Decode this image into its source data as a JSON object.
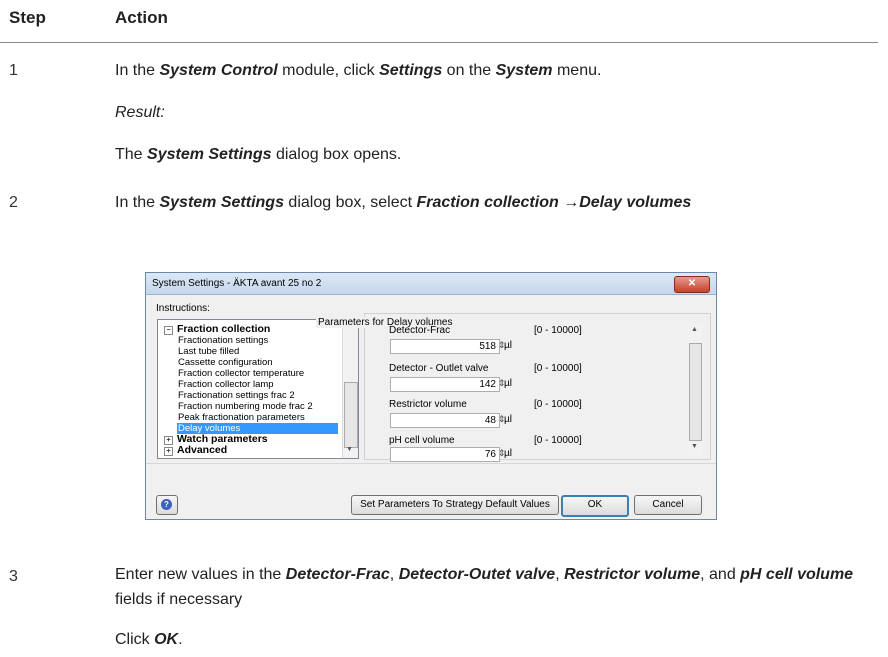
{
  "header": {
    "step": "Step",
    "action": "Action"
  },
  "steps": [
    {
      "num": "1",
      "line1": {
        "a": "In the ",
        "b": "System Control",
        "c": " module, click ",
        "d": "Settings",
        "e": " on the ",
        "f": "System",
        "g": " menu."
      },
      "result_label": "Result:",
      "result": {
        "a": "The ",
        "b": "System Settings",
        "c": " dialog box opens."
      }
    },
    {
      "num": "2",
      "line1": {
        "a": "In the ",
        "b": "System Settings",
        "c": " dialog box, select ",
        "d": "Fraction collection",
        "e": " →",
        "f": "Delay volumes"
      }
    },
    {
      "num": "3",
      "line1": {
        "a": "Enter new values in the ",
        "b": "Detector-Frac",
        "c": ", ",
        "d": "Detector-Outet valve",
        "e": ", ",
        "f": "Restrictor volume",
        "g": ", and ",
        "h": "pH cell volume",
        "i": " fields if necessary"
      },
      "line2": {
        "a": "Click ",
        "b": "OK",
        "c": "."
      }
    }
  ],
  "dialog": {
    "title": "System Settings - ÄKTA avant 25  no 2",
    "close": "✕",
    "instructions_label": "Instructions:",
    "tree": [
      {
        "label": "Fraction collection",
        "level": "top",
        "expander": "−"
      },
      {
        "label": "Fractionation settings",
        "level": "child"
      },
      {
        "label": "Last tube filled",
        "level": "child"
      },
      {
        "label": "Cassette configuration",
        "level": "child"
      },
      {
        "label": "Fraction collector temperature",
        "level": "child"
      },
      {
        "label": "Fraction collector lamp",
        "level": "child"
      },
      {
        "label": "Fractionation settings frac 2",
        "level": "child"
      },
      {
        "label": "Fraction numbering mode frac 2",
        "level": "child"
      },
      {
        "label": "Peak fractionation parameters",
        "level": "child"
      },
      {
        "label": "Delay volumes",
        "level": "child",
        "selected": true
      },
      {
        "label": "Watch parameters",
        "level": "top",
        "expander": "+"
      },
      {
        "label": "Advanced",
        "level": "top",
        "expander": "+"
      }
    ],
    "params_group": "Parameters for Delay volumes",
    "params": [
      {
        "label": "Detector-Frac",
        "range": "[0 - 10000]",
        "value": "518",
        "unit": "µl"
      },
      {
        "label": "Detector - Outlet valve",
        "range": "[0 - 10000]",
        "value": "142",
        "unit": "µl"
      },
      {
        "label": "Restrictor volume",
        "range": "[0 - 10000]",
        "value": "48",
        "unit": "µl"
      },
      {
        "label": "pH cell volume",
        "range": "[0 - 10000]",
        "value": "76",
        "unit": "µl"
      }
    ],
    "buttons": {
      "default": "Set Parameters To Strategy Default Values",
      "ok": "OK",
      "cancel": "Cancel"
    }
  }
}
